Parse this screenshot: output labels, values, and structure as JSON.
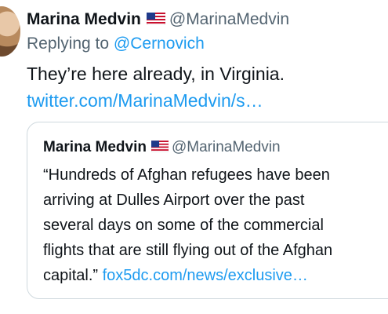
{
  "tweet": {
    "name": "Marina Medvin",
    "flag": "US flag emoji",
    "handle": "@MarinaMedvin",
    "reply_prefix": "Replying to",
    "reply_to": "@Cernovich",
    "text": "They’re here already, in Virginia.",
    "link": "twitter.com/MarinaMedvin/s…"
  },
  "quote": {
    "name": "Marina Medvin",
    "handle": "@MarinaMedvin",
    "lines": [
      "“Hundreds of Afghan refugees have been",
      "arriving at Dulles Airport over the past",
      "several days on some of the commercial",
      "flights that are still flying out of the Afghan"
    ],
    "last_line_text": "capital.”",
    "link": "fox5dc.com/news/exclusive…"
  },
  "colors": {
    "text": "#0f1419",
    "secondary": "#536471",
    "link": "#1d9bf0",
    "border": "#cfd9de"
  }
}
